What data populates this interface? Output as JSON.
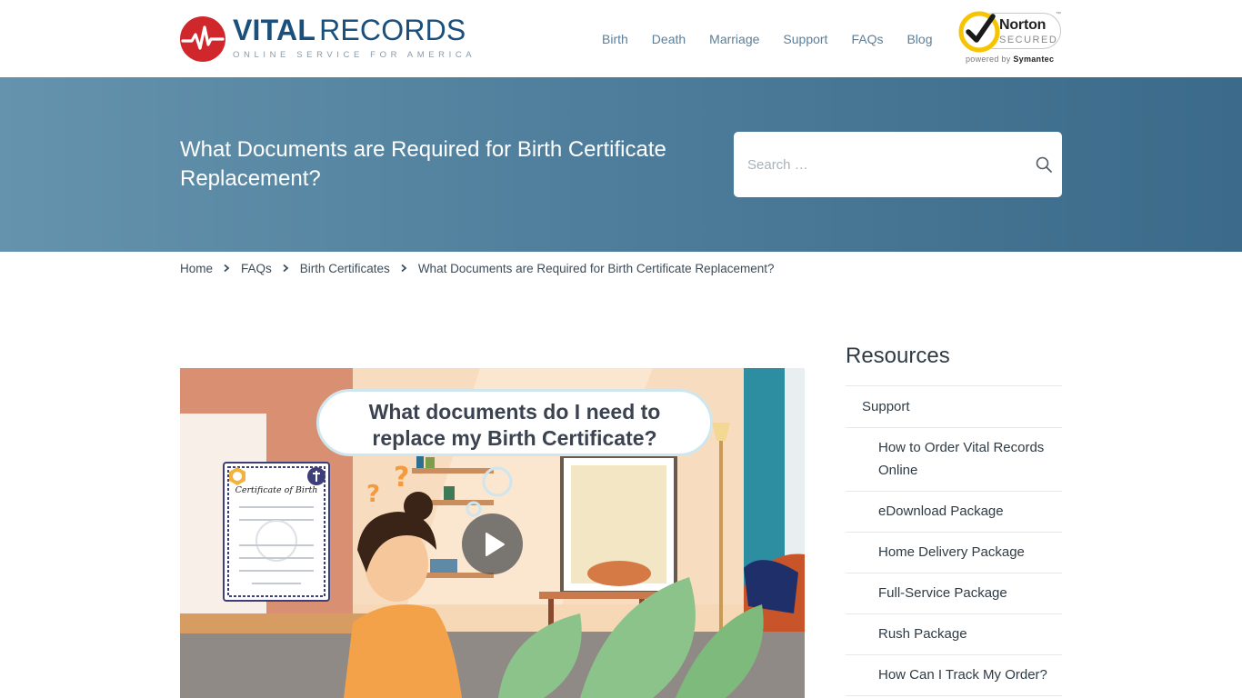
{
  "brand": {
    "title_bold": "VITAL",
    "title_light": "RECORDS",
    "tagline": "ONLINE SERVICE FOR AMERICA"
  },
  "nav": {
    "items": [
      {
        "label": "Birth"
      },
      {
        "label": "Death"
      },
      {
        "label": "Marriage"
      },
      {
        "label": "Support"
      },
      {
        "label": "FAQs"
      },
      {
        "label": "Blog"
      }
    ]
  },
  "norton": {
    "name": "Norton",
    "secured": "SECURED",
    "tm": "™",
    "powered_by": "powered by",
    "vendor": "Symantec"
  },
  "hero": {
    "title": "What Documents are Required for Birth Certificate Replacement?"
  },
  "search": {
    "placeholder": "Search …"
  },
  "breadcrumb": {
    "items": [
      {
        "label": "Home"
      },
      {
        "label": "FAQs"
      },
      {
        "label": "Birth Certificates"
      },
      {
        "label": "What Documents are Required for Birth Certificate Replacement?"
      }
    ]
  },
  "video": {
    "bubble_line1": "What documents do I need to",
    "bubble_line2": "replace my Birth Certificate?",
    "certificate_title": "Certificate of Birth"
  },
  "sidebar": {
    "title": "Resources",
    "parent": {
      "label": "Support"
    },
    "children": [
      {
        "label": "How to Order Vital Records Online"
      },
      {
        "label": "eDownload Package"
      },
      {
        "label": "Home Delivery Package"
      },
      {
        "label": "Full-Service Package"
      },
      {
        "label": "Rush Package"
      },
      {
        "label": "How Can I Track My Order?"
      }
    ]
  },
  "colors": {
    "brand_blue": "#1b4f7c",
    "hero_start": "#6593ad",
    "hero_end": "#3b6a8a",
    "logo_red": "#d0272c",
    "norton_yellow": "#f6c400"
  }
}
